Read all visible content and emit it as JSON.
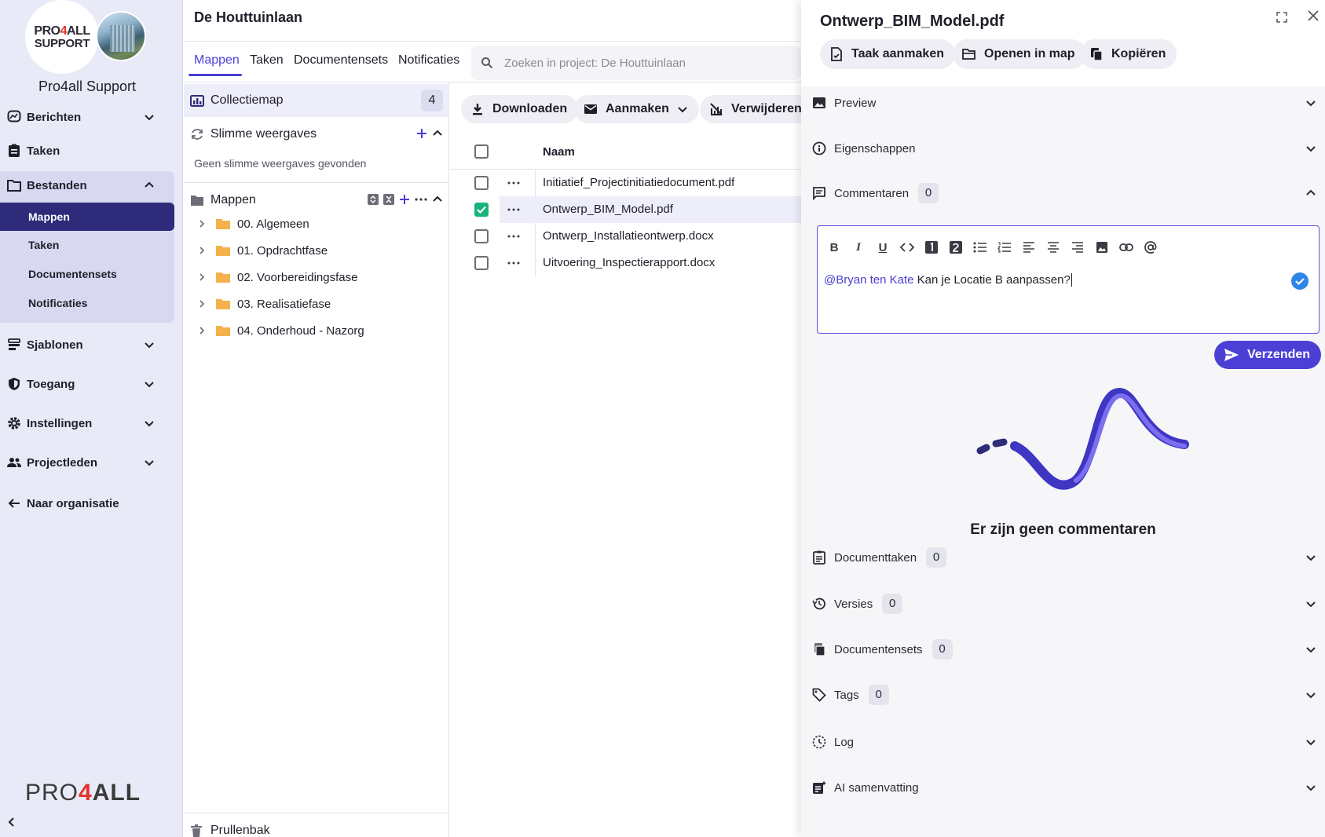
{
  "sidebar": {
    "org_logo_line1_a": "PRO",
    "org_logo_line1_b": "4",
    "org_logo_line1_c": "ALL",
    "org_logo_line2": "SUPPORT",
    "org_name": "Pro4all Support",
    "items": [
      {
        "label": "Berichten",
        "icon": "messages-icon"
      },
      {
        "label": "Taken",
        "icon": "clipboard-icon"
      },
      {
        "label": "Bestanden",
        "icon": "folder-outline-icon"
      },
      {
        "label": "Sjablonen",
        "icon": "template-icon"
      },
      {
        "label": "Toegang",
        "icon": "shield-icon"
      },
      {
        "label": "Instellingen",
        "icon": "gear-icon"
      },
      {
        "label": "Projectleden",
        "icon": "people-icon"
      },
      {
        "label": "Naar organisatie",
        "icon": "arrow-left-icon"
      }
    ],
    "bestanden_sub": [
      "Mappen",
      "Taken",
      "Documentensets",
      "Notificaties"
    ],
    "brand_a": "PRO",
    "brand_b": "4",
    "brand_c": "ALL"
  },
  "project": {
    "title": "De Houttuinlaan",
    "tabs": [
      "Mappen",
      "Taken",
      "Documentensets",
      "Notificaties"
    ],
    "search_placeholder": "Zoeken in project: De Houttuinlaan"
  },
  "folders": {
    "collectie_label": "Collectiemap",
    "collectie_count": "4",
    "smart_label": "Slimme weergaves",
    "smart_empty": "Geen slimme weergaves gevonden",
    "mappen_label": "Mappen",
    "items": [
      "00. Algemeen",
      "01. Opdrachtfase",
      "02. Voorbereidingsfase",
      "03. Realisatiefase",
      "04. Onderhoud - Nazorg"
    ],
    "trash_label": "Prullenbak"
  },
  "files": {
    "toolbar": {
      "download": "Downloaden",
      "create": "Aanmaken",
      "delete": "Verwijderen"
    },
    "column_name": "Naam",
    "rows": [
      {
        "name": "Initiatief_Projectinitiatiedocument.pdf",
        "checked": false
      },
      {
        "name": "Ontwerp_BIM_Model.pdf",
        "checked": true
      },
      {
        "name": "Ontwerp_Installatieontwerp.docx",
        "checked": false
      },
      {
        "name": "Uitvoering_Inspectierapport.docx",
        "checked": false
      }
    ]
  },
  "detail": {
    "title": "Ontwerp_BIM_Model.pdf",
    "actions": {
      "task": "Taak aanmaken",
      "open": "Openen in map",
      "copy": "Kopiëren"
    },
    "sections": {
      "preview": "Preview",
      "properties": "Eigenschappen",
      "comments": "Commentaren",
      "comments_count": "0",
      "doc_tasks": "Documenttaken",
      "doc_tasks_count": "0",
      "versions": "Versies",
      "versions_count": "0",
      "doc_sets": "Documentensets",
      "doc_sets_count": "0",
      "tags": "Tags",
      "tags_count": "0",
      "log": "Log",
      "ai": "AI samenvatting"
    },
    "editor": {
      "mention": "@Bryan ten Kate",
      "text": " Kan je Locatie B aanpassen?"
    },
    "send_label": "Verzenden",
    "empty_text": "Er zijn geen commentaren"
  },
  "colors": {
    "accent": "#4b3fd6",
    "nav_active": "#2d2b7a",
    "checkbox_checked": "#18b57a",
    "folder": "#f4b14c"
  }
}
